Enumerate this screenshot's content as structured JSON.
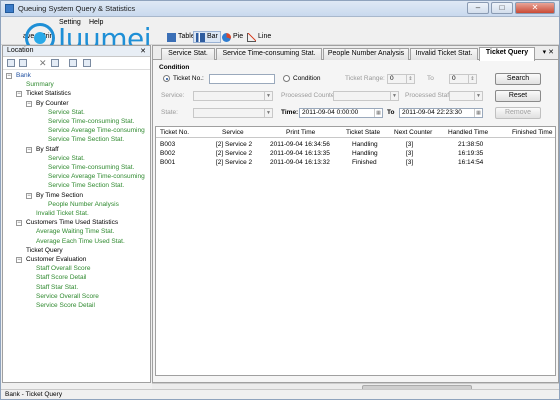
{
  "window": {
    "title": "Queuing System Query & Statistics"
  },
  "menu": [
    "Setting",
    "Help"
  ],
  "toolbar": {
    "items": [
      "ave",
      "Prin",
      "Table",
      "Bar",
      "Pie",
      "Line"
    ]
  },
  "logo": {
    "text": "Juumei"
  },
  "left_panel": {
    "title": "Location",
    "tree": [
      {
        "label": "Bank",
        "level": 0
      },
      {
        "label": "Summary",
        "level": 1
      },
      {
        "label": "Ticket Statistics",
        "level": 1
      },
      {
        "label": "By Counter",
        "level": 2
      },
      {
        "label": "Service Stat.",
        "level": 3
      },
      {
        "label": "Service Time-consuming Stat.",
        "level": 3
      },
      {
        "label": "Service Average Time-consuming",
        "level": 3
      },
      {
        "label": "Service Time Section Stat.",
        "level": 3
      },
      {
        "label": "By Staff",
        "level": 2
      },
      {
        "label": "Service Stat.",
        "level": 3
      },
      {
        "label": "Service Time-consuming Stat.",
        "level": 3
      },
      {
        "label": "Service Average Time-consuming",
        "level": 3
      },
      {
        "label": "Service Time Section Stat.",
        "level": 3
      },
      {
        "label": "By Time Section",
        "level": 2
      },
      {
        "label": "People Number Analysis",
        "level": 3
      },
      {
        "label": "Invalid Ticket Stat.",
        "level": 2
      },
      {
        "label": "Customers Time Used Statistics",
        "level": 1
      },
      {
        "label": "Average Waiting Time Stat.",
        "level": 2
      },
      {
        "label": "Average Each Time Used Stat.",
        "level": 2
      },
      {
        "label": "Ticket Query",
        "level": 1
      },
      {
        "label": "Customer Evaluation",
        "level": 1
      },
      {
        "label": "Staff Overall Score",
        "level": 2
      },
      {
        "label": "Staff Score Detail",
        "level": 2
      },
      {
        "label": "Staff Star Stat.",
        "level": 2
      },
      {
        "label": "Service Overall Score",
        "level": 2
      },
      {
        "label": "Service Score Detail",
        "level": 2
      }
    ]
  },
  "tabs": [
    "Service Stat.",
    "Service Time-consuming Stat.",
    "People Number Analysis",
    "Invalid Ticket Stat.",
    "Ticket Query"
  ],
  "condition": {
    "group_label": "Condition",
    "ticket_no_label": "Ticket No.:",
    "condition_label": "Condition",
    "ticket_range_label": "Ticket Range:",
    "to_label": "To",
    "range_from": "0",
    "range_to": "0",
    "service_label": "Service:",
    "processed_counter_label": "Processed Counter:",
    "processed_staff_label": "Processed Staff:",
    "state_label": "State:",
    "time_label": "Time:",
    "time_from": "2011-09-04  0:00:00",
    "time_to": "2011-09-04 22:23:30",
    "search_btn": "Search",
    "reset_btn": "Reset",
    "remove_btn": "Remove"
  },
  "grid": {
    "columns": [
      "Ticket No.",
      "Service",
      "Print Time",
      "Ticket State",
      "Next Counter",
      "Handled Time",
      "Finished Time"
    ],
    "rows": [
      [
        "B003",
        "[2] Service 2",
        "2011-09-04 16:34:56",
        "Handling",
        "[3]",
        "21:38:50",
        ""
      ],
      [
        "B002",
        "[2] Service 2",
        "2011-09-04 16:13:35",
        "Handling",
        "[3]",
        "16:19:35",
        ""
      ],
      [
        "B001",
        "[2] Service 2",
        "2011-09-04 16:13:32",
        "Finished",
        "[3]",
        "16:14:54",
        ""
      ]
    ]
  },
  "status": {
    "text": "Bank - Ticket Query"
  }
}
